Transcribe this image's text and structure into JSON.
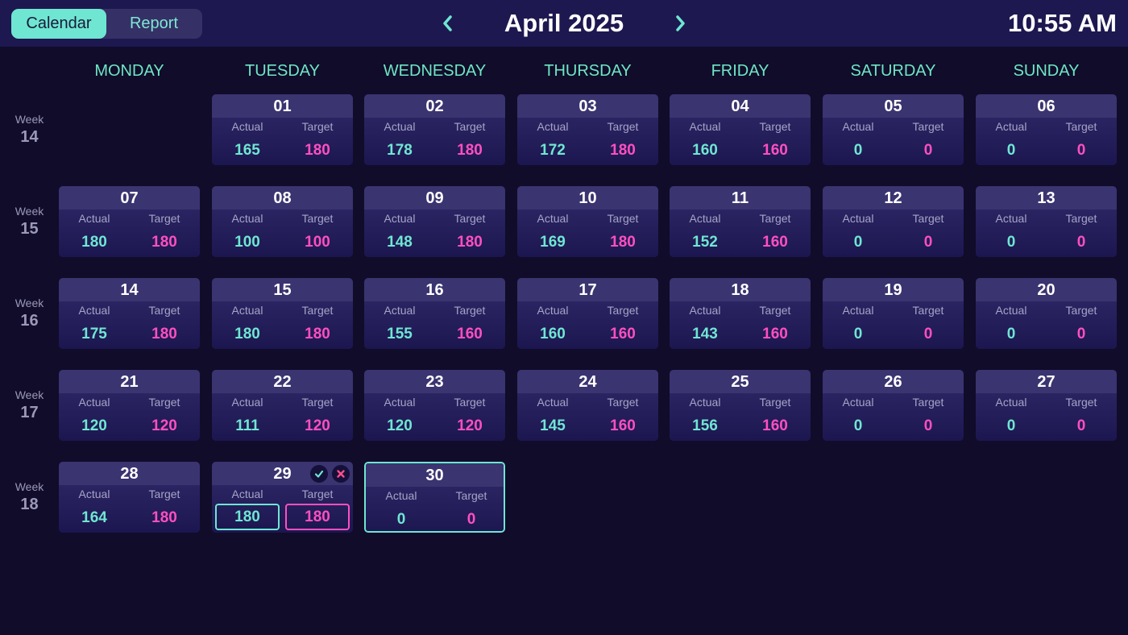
{
  "header": {
    "tabs": [
      {
        "label": "Calendar",
        "active": true
      },
      {
        "label": "Report",
        "active": false
      }
    ],
    "month_title": "April 2025",
    "clock": "10:55 AM",
    "prev_icon": "chevron-left-icon",
    "next_icon": "chevron-right-icon"
  },
  "days_of_week": [
    "MONDAY",
    "TUESDAY",
    "WEDNESDAY",
    "THURSDAY",
    "FRIDAY",
    "SATURDAY",
    "SUNDAY"
  ],
  "labels": {
    "week": "Week",
    "actual": "Actual",
    "target": "Target"
  },
  "weeks": [
    {
      "number": "14",
      "days": [
        null,
        {
          "date": "01",
          "actual": "165",
          "target": "180"
        },
        {
          "date": "02",
          "actual": "178",
          "target": "180"
        },
        {
          "date": "03",
          "actual": "172",
          "target": "180"
        },
        {
          "date": "04",
          "actual": "160",
          "target": "160"
        },
        {
          "date": "05",
          "actual": "0",
          "target": "0"
        },
        {
          "date": "06",
          "actual": "0",
          "target": "0"
        }
      ]
    },
    {
      "number": "15",
      "days": [
        {
          "date": "07",
          "actual": "180",
          "target": "180"
        },
        {
          "date": "08",
          "actual": "100",
          "target": "100"
        },
        {
          "date": "09",
          "actual": "148",
          "target": "180"
        },
        {
          "date": "10",
          "actual": "169",
          "target": "180"
        },
        {
          "date": "11",
          "actual": "152",
          "target": "160"
        },
        {
          "date": "12",
          "actual": "0",
          "target": "0"
        },
        {
          "date": "13",
          "actual": "0",
          "target": "0"
        }
      ]
    },
    {
      "number": "16",
      "days": [
        {
          "date": "14",
          "actual": "175",
          "target": "180"
        },
        {
          "date": "15",
          "actual": "180",
          "target": "180"
        },
        {
          "date": "16",
          "actual": "155",
          "target": "160"
        },
        {
          "date": "17",
          "actual": "160",
          "target": "160"
        },
        {
          "date": "18",
          "actual": "143",
          "target": "160"
        },
        {
          "date": "19",
          "actual": "0",
          "target": "0"
        },
        {
          "date": "20",
          "actual": "0",
          "target": "0"
        }
      ]
    },
    {
      "number": "17",
      "days": [
        {
          "date": "21",
          "actual": "120",
          "target": "120"
        },
        {
          "date": "22",
          "actual": "111",
          "target": "120"
        },
        {
          "date": "23",
          "actual": "120",
          "target": "120"
        },
        {
          "date": "24",
          "actual": "145",
          "target": "160"
        },
        {
          "date": "25",
          "actual": "156",
          "target": "160"
        },
        {
          "date": "26",
          "actual": "0",
          "target": "0"
        },
        {
          "date": "27",
          "actual": "0",
          "target": "0"
        }
      ]
    },
    {
      "number": "18",
      "days": [
        {
          "date": "28",
          "actual": "164",
          "target": "180"
        },
        {
          "date": "29",
          "actual": "180",
          "target": "180",
          "editing": true
        },
        {
          "date": "30",
          "actual": "0",
          "target": "0",
          "today": true
        },
        null,
        null,
        null,
        null
      ]
    }
  ],
  "edit_icons": {
    "confirm": "check-icon",
    "cancel": "x-close-icon"
  },
  "colors": {
    "accent": "#6fe6d2",
    "target": "#ff4fc0",
    "background": "#100c2a",
    "header": "#1d1850",
    "card": "#221c58"
  }
}
